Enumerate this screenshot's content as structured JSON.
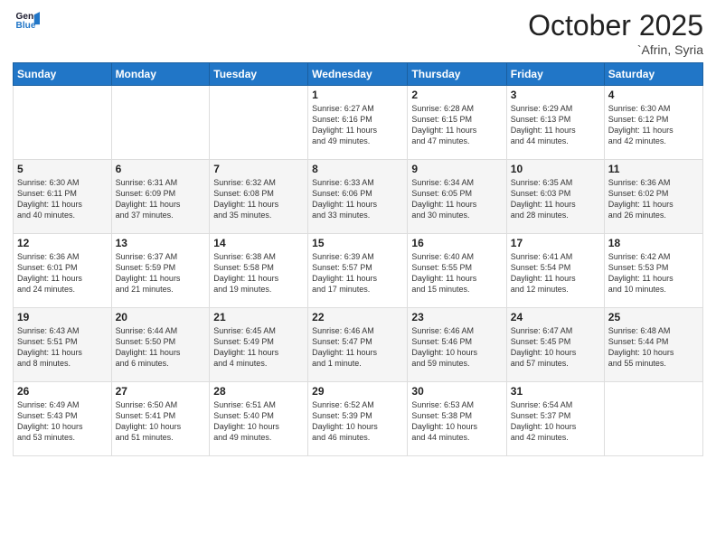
{
  "header": {
    "logo_line1": "General",
    "logo_line2": "Blue",
    "month": "October 2025",
    "location": "`Afrin, Syria"
  },
  "weekdays": [
    "Sunday",
    "Monday",
    "Tuesday",
    "Wednesday",
    "Thursday",
    "Friday",
    "Saturday"
  ],
  "weeks": [
    [
      {
        "day": "",
        "content": ""
      },
      {
        "day": "",
        "content": ""
      },
      {
        "day": "",
        "content": ""
      },
      {
        "day": "1",
        "content": "Sunrise: 6:27 AM\nSunset: 6:16 PM\nDaylight: 11 hours\nand 49 minutes."
      },
      {
        "day": "2",
        "content": "Sunrise: 6:28 AM\nSunset: 6:15 PM\nDaylight: 11 hours\nand 47 minutes."
      },
      {
        "day": "3",
        "content": "Sunrise: 6:29 AM\nSunset: 6:13 PM\nDaylight: 11 hours\nand 44 minutes."
      },
      {
        "day": "4",
        "content": "Sunrise: 6:30 AM\nSunset: 6:12 PM\nDaylight: 11 hours\nand 42 minutes."
      }
    ],
    [
      {
        "day": "5",
        "content": "Sunrise: 6:30 AM\nSunset: 6:11 PM\nDaylight: 11 hours\nand 40 minutes."
      },
      {
        "day": "6",
        "content": "Sunrise: 6:31 AM\nSunset: 6:09 PM\nDaylight: 11 hours\nand 37 minutes."
      },
      {
        "day": "7",
        "content": "Sunrise: 6:32 AM\nSunset: 6:08 PM\nDaylight: 11 hours\nand 35 minutes."
      },
      {
        "day": "8",
        "content": "Sunrise: 6:33 AM\nSunset: 6:06 PM\nDaylight: 11 hours\nand 33 minutes."
      },
      {
        "day": "9",
        "content": "Sunrise: 6:34 AM\nSunset: 6:05 PM\nDaylight: 11 hours\nand 30 minutes."
      },
      {
        "day": "10",
        "content": "Sunrise: 6:35 AM\nSunset: 6:03 PM\nDaylight: 11 hours\nand 28 minutes."
      },
      {
        "day": "11",
        "content": "Sunrise: 6:36 AM\nSunset: 6:02 PM\nDaylight: 11 hours\nand 26 minutes."
      }
    ],
    [
      {
        "day": "12",
        "content": "Sunrise: 6:36 AM\nSunset: 6:01 PM\nDaylight: 11 hours\nand 24 minutes."
      },
      {
        "day": "13",
        "content": "Sunrise: 6:37 AM\nSunset: 5:59 PM\nDaylight: 11 hours\nand 21 minutes."
      },
      {
        "day": "14",
        "content": "Sunrise: 6:38 AM\nSunset: 5:58 PM\nDaylight: 11 hours\nand 19 minutes."
      },
      {
        "day": "15",
        "content": "Sunrise: 6:39 AM\nSunset: 5:57 PM\nDaylight: 11 hours\nand 17 minutes."
      },
      {
        "day": "16",
        "content": "Sunrise: 6:40 AM\nSunset: 5:55 PM\nDaylight: 11 hours\nand 15 minutes."
      },
      {
        "day": "17",
        "content": "Sunrise: 6:41 AM\nSunset: 5:54 PM\nDaylight: 11 hours\nand 12 minutes."
      },
      {
        "day": "18",
        "content": "Sunrise: 6:42 AM\nSunset: 5:53 PM\nDaylight: 11 hours\nand 10 minutes."
      }
    ],
    [
      {
        "day": "19",
        "content": "Sunrise: 6:43 AM\nSunset: 5:51 PM\nDaylight: 11 hours\nand 8 minutes."
      },
      {
        "day": "20",
        "content": "Sunrise: 6:44 AM\nSunset: 5:50 PM\nDaylight: 11 hours\nand 6 minutes."
      },
      {
        "day": "21",
        "content": "Sunrise: 6:45 AM\nSunset: 5:49 PM\nDaylight: 11 hours\nand 4 minutes."
      },
      {
        "day": "22",
        "content": "Sunrise: 6:46 AM\nSunset: 5:47 PM\nDaylight: 11 hours\nand 1 minute."
      },
      {
        "day": "23",
        "content": "Sunrise: 6:46 AM\nSunset: 5:46 PM\nDaylight: 10 hours\nand 59 minutes."
      },
      {
        "day": "24",
        "content": "Sunrise: 6:47 AM\nSunset: 5:45 PM\nDaylight: 10 hours\nand 57 minutes."
      },
      {
        "day": "25",
        "content": "Sunrise: 6:48 AM\nSunset: 5:44 PM\nDaylight: 10 hours\nand 55 minutes."
      }
    ],
    [
      {
        "day": "26",
        "content": "Sunrise: 6:49 AM\nSunset: 5:43 PM\nDaylight: 10 hours\nand 53 minutes."
      },
      {
        "day": "27",
        "content": "Sunrise: 6:50 AM\nSunset: 5:41 PM\nDaylight: 10 hours\nand 51 minutes."
      },
      {
        "day": "28",
        "content": "Sunrise: 6:51 AM\nSunset: 5:40 PM\nDaylight: 10 hours\nand 49 minutes."
      },
      {
        "day": "29",
        "content": "Sunrise: 6:52 AM\nSunset: 5:39 PM\nDaylight: 10 hours\nand 46 minutes."
      },
      {
        "day": "30",
        "content": "Sunrise: 6:53 AM\nSunset: 5:38 PM\nDaylight: 10 hours\nand 44 minutes."
      },
      {
        "day": "31",
        "content": "Sunrise: 6:54 AM\nSunset: 5:37 PM\nDaylight: 10 hours\nand 42 minutes."
      },
      {
        "day": "",
        "content": ""
      }
    ]
  ]
}
